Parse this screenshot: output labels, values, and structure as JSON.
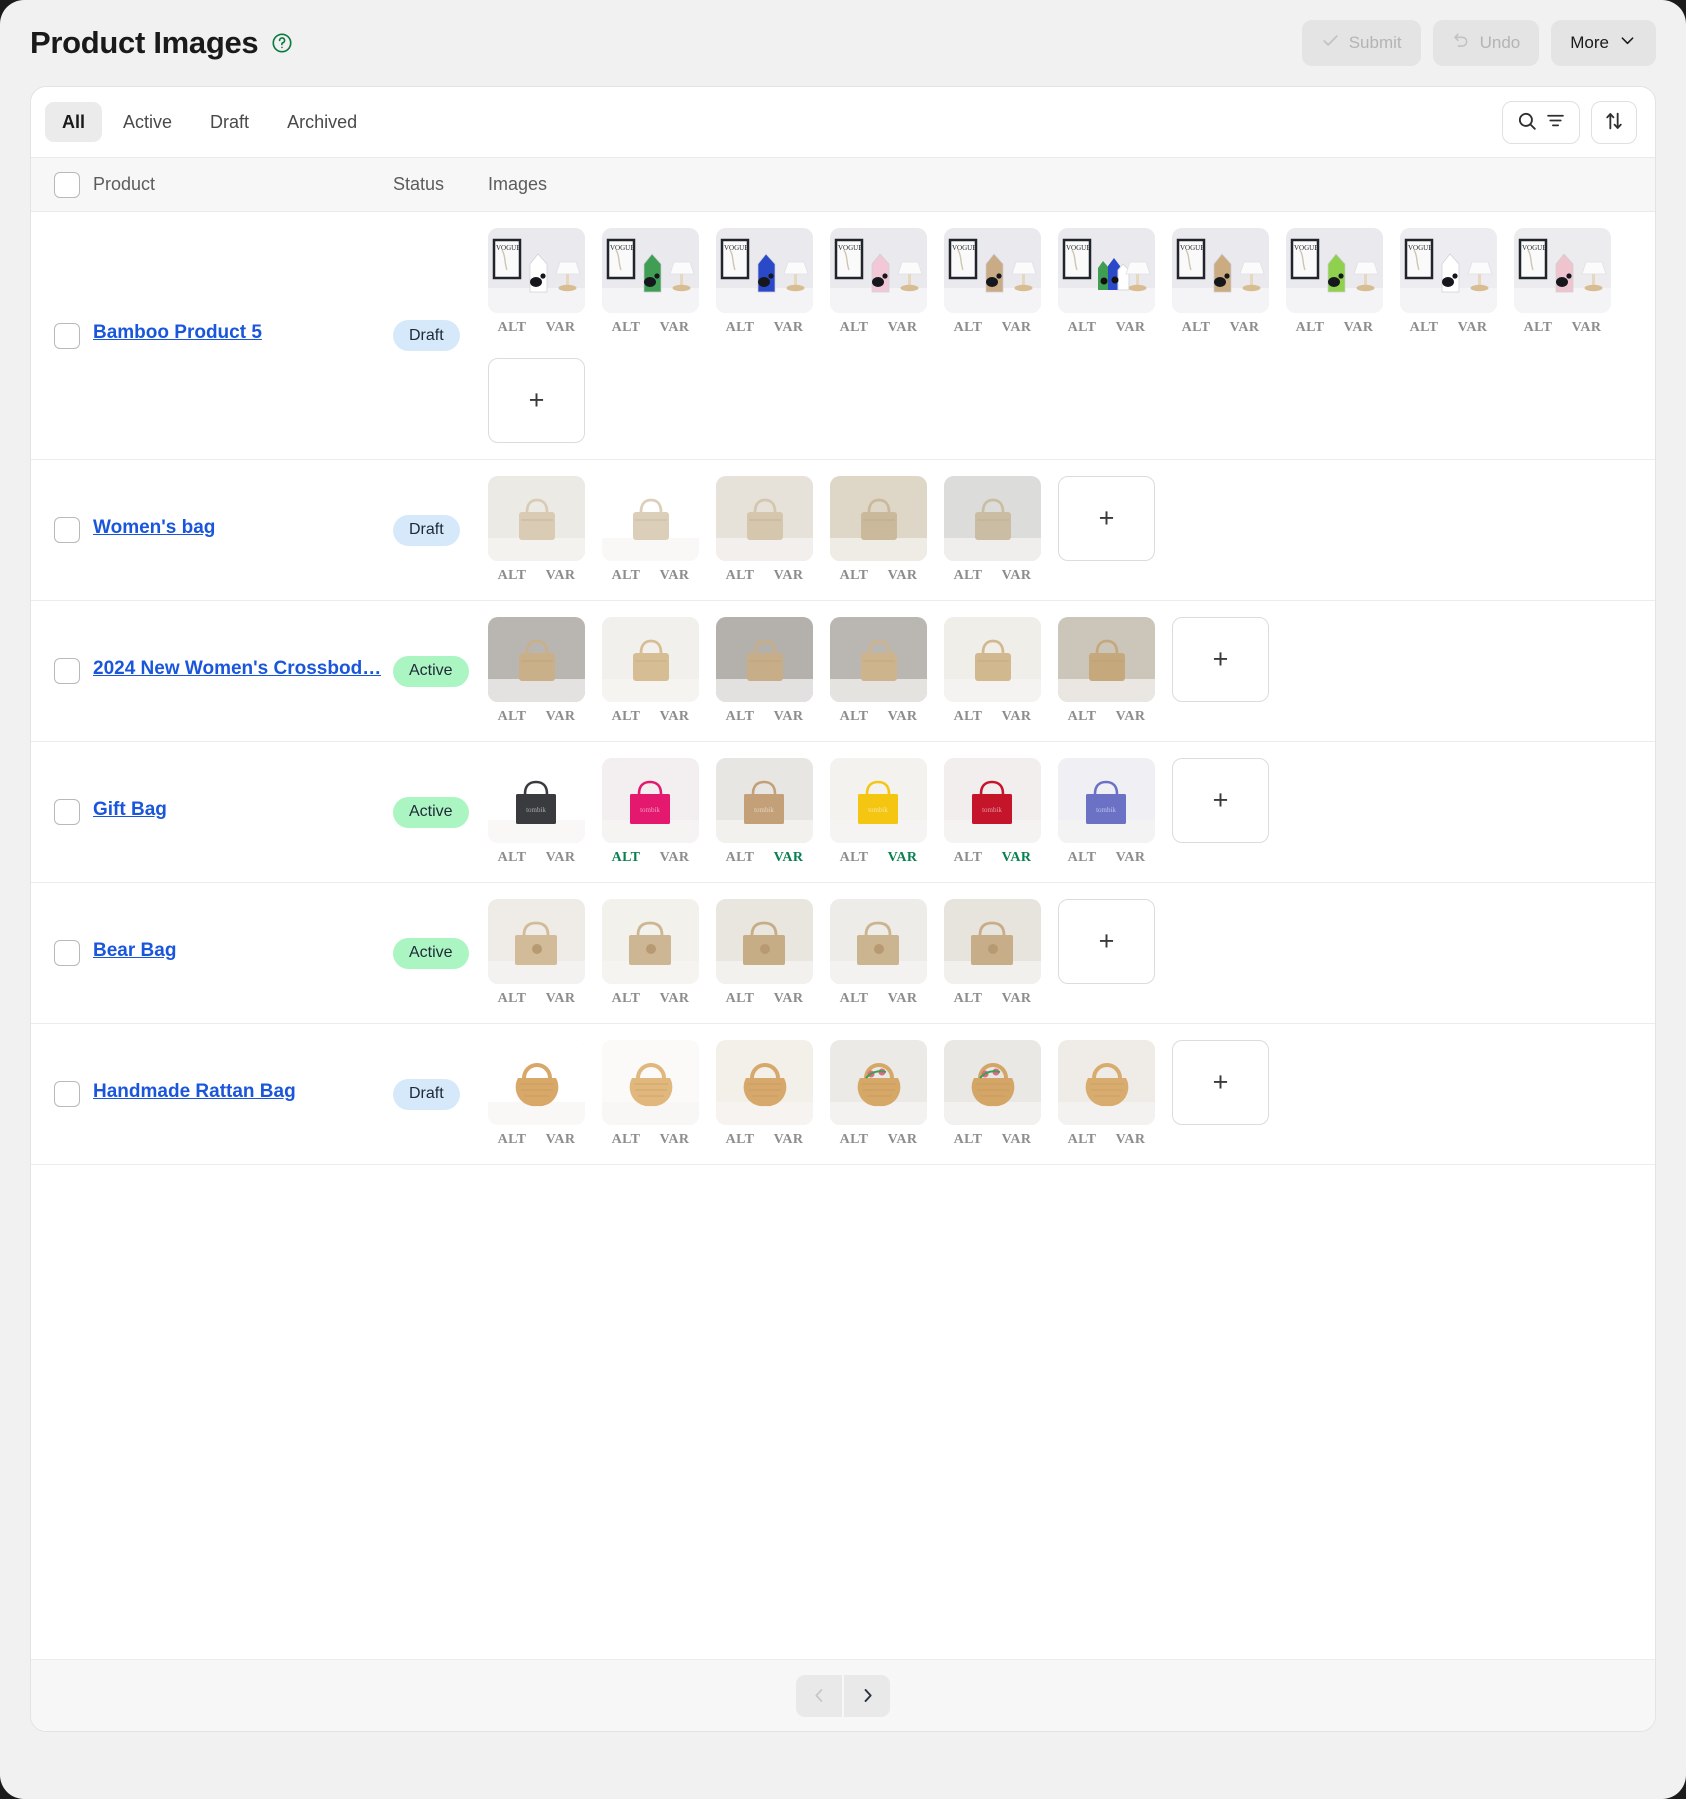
{
  "header": {
    "title": "Product Images",
    "help_icon": "question-circle-icon",
    "buttons": [
      {
        "label": "Submit",
        "icon": "check-icon",
        "disabled": true
      },
      {
        "label": "Undo",
        "icon": "undo-icon",
        "disabled": true
      },
      {
        "label": "More",
        "icon": "chevron-down-icon",
        "disabled": false
      }
    ]
  },
  "toolbar": {
    "tabs": [
      {
        "label": "All",
        "selected": true
      },
      {
        "label": "Active",
        "selected": false
      },
      {
        "label": "Draft",
        "selected": false
      },
      {
        "label": "Archived",
        "selected": false
      }
    ],
    "search_icon": "search-icon",
    "filter_icon": "filter-icon",
    "sort_icon": "sort-arrows-icon"
  },
  "table": {
    "columns": [
      "Product",
      "Status",
      "Images"
    ],
    "labels": {
      "alt": "ALT",
      "var": "VAR",
      "add": "+"
    },
    "rows": [
      {
        "name": "Bamboo Product 5",
        "status": "Draft",
        "status_type": "draft",
        "images": [
          {
            "kind": "panda-white",
            "alt_on": false,
            "var_on": false
          },
          {
            "kind": "panda-green",
            "alt_on": false,
            "var_on": false
          },
          {
            "kind": "panda-blue",
            "alt_on": false,
            "var_on": false
          },
          {
            "kind": "panda-pink",
            "alt_on": false,
            "var_on": false
          },
          {
            "kind": "panda-tan",
            "alt_on": false,
            "var_on": false
          },
          {
            "kind": "panda-group",
            "alt_on": false,
            "var_on": false
          },
          {
            "kind": "panda-tan2",
            "alt_on": false,
            "var_on": false
          },
          {
            "kind": "panda-lime",
            "alt_on": false,
            "var_on": false
          },
          {
            "kind": "panda-flat",
            "alt_on": false,
            "var_on": false
          },
          {
            "kind": "panda-rose",
            "alt_on": false,
            "var_on": false
          }
        ],
        "has_add": true
      },
      {
        "name": "Women's bag",
        "status": "Draft",
        "status_type": "draft",
        "images": [
          {
            "kind": "beige-shell",
            "alt_on": false,
            "var_on": false
          },
          {
            "kind": "beige-plain",
            "alt_on": false,
            "var_on": false
          },
          {
            "kind": "beige-shell2",
            "alt_on": false,
            "var_on": false
          },
          {
            "kind": "beige-quilt",
            "alt_on": false,
            "var_on": false
          },
          {
            "kind": "beige-grey",
            "alt_on": false,
            "var_on": false
          }
        ],
        "has_add": true
      },
      {
        "name": "2024 New Women's Crossbod…",
        "status": "Active",
        "status_type": "active",
        "images": [
          {
            "kind": "model-tote",
            "alt_on": false,
            "var_on": false
          },
          {
            "kind": "straw-tote",
            "alt_on": false,
            "var_on": false
          },
          {
            "kind": "model-tote2",
            "alt_on": false,
            "var_on": false
          },
          {
            "kind": "model-tote3",
            "alt_on": false,
            "var_on": false
          },
          {
            "kind": "straw-tote2",
            "alt_on": false,
            "var_on": false
          },
          {
            "kind": "straw-charm",
            "alt_on": false,
            "var_on": false
          }
        ],
        "has_add": true
      },
      {
        "name": "Gift Bag",
        "status": "Active",
        "status_type": "active",
        "images": [
          {
            "kind": "gift-black",
            "alt_on": false,
            "var_on": false
          },
          {
            "kind": "gift-pink",
            "alt_on": true,
            "var_on": false
          },
          {
            "kind": "gift-kraft",
            "alt_on": false,
            "var_on": true
          },
          {
            "kind": "gift-yellow",
            "alt_on": false,
            "var_on": true
          },
          {
            "kind": "gift-red",
            "alt_on": false,
            "var_on": true
          },
          {
            "kind": "gift-blue",
            "alt_on": false,
            "var_on": false
          }
        ],
        "has_add": true
      },
      {
        "name": "Bear Bag",
        "status": "Active",
        "status_type": "active",
        "images": [
          {
            "kind": "bear-bed",
            "alt_on": false,
            "var_on": false
          },
          {
            "kind": "bear-toy",
            "alt_on": false,
            "var_on": false
          },
          {
            "kind": "bear-pair",
            "alt_on": false,
            "var_on": false
          },
          {
            "kind": "bear-flat",
            "alt_on": false,
            "var_on": false
          },
          {
            "kind": "bear-trio",
            "alt_on": false,
            "var_on": false
          }
        ],
        "has_add": true
      },
      {
        "name": "Handmade Rattan Bag",
        "status": "Draft",
        "status_type": "draft",
        "images": [
          {
            "kind": "rattan-fan",
            "alt_on": false,
            "var_on": false
          },
          {
            "kind": "rattan-round",
            "alt_on": false,
            "var_on": false
          },
          {
            "kind": "rattan-half",
            "alt_on": false,
            "var_on": false
          },
          {
            "kind": "rattan-flower",
            "alt_on": false,
            "var_on": false
          },
          {
            "kind": "rattan-flower2",
            "alt_on": false,
            "var_on": false
          },
          {
            "kind": "rattan-pair",
            "alt_on": false,
            "var_on": false
          }
        ],
        "has_add": true
      }
    ]
  },
  "pagination": {
    "prev_icon": "chevron-left-icon",
    "next_icon": "chevron-right-icon",
    "prev_disabled": true,
    "next_disabled": false
  },
  "colors": {
    "link": "#1a56db",
    "badge_draft_bg": "#d6e9fb",
    "badge_active_bg": "#abf5c3",
    "label_on": "#0a8050",
    "label_off": "#8d8d8d"
  }
}
